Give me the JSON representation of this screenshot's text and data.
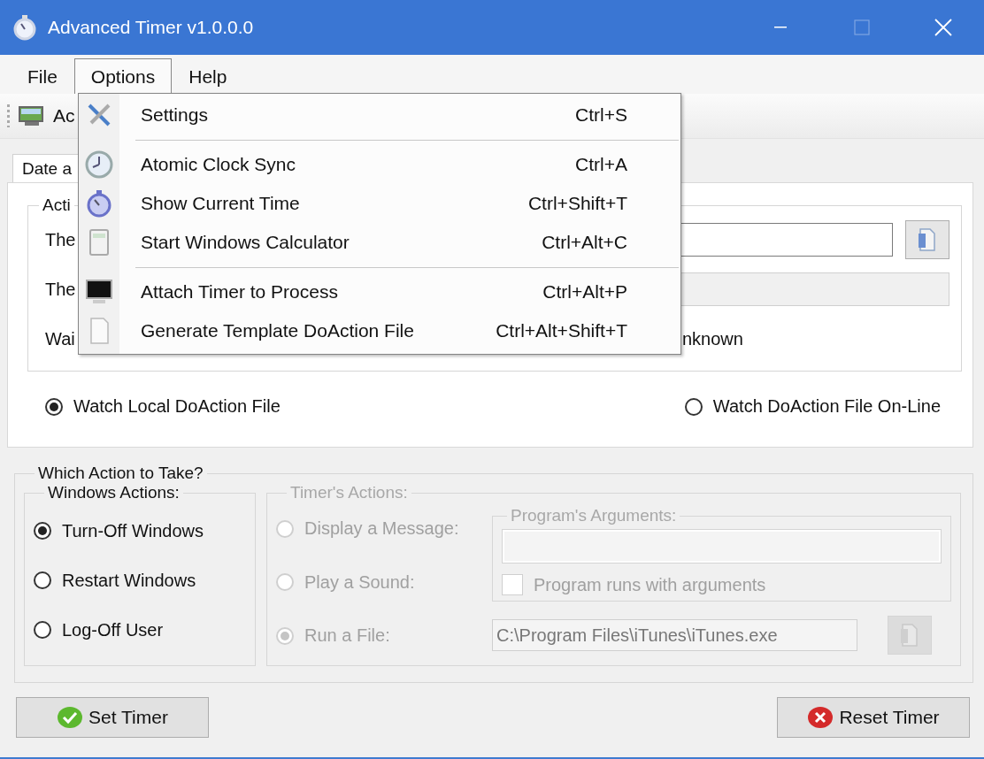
{
  "window": {
    "title": "Advanced Timer v1.0.0.0"
  },
  "menu_bar": [
    {
      "label": "File",
      "selected": false
    },
    {
      "label": "Options",
      "selected": true
    },
    {
      "label": "Help",
      "selected": false
    }
  ],
  "open_menu": {
    "items": [
      {
        "kind": "item",
        "label": "Settings",
        "shortcut": "Ctrl+S"
      },
      {
        "kind": "separator"
      },
      {
        "kind": "item",
        "label": "Atomic Clock Sync",
        "shortcut": "Ctrl+A"
      },
      {
        "kind": "item",
        "label": "Show Current Time",
        "shortcut": "Ctrl+Shift+T"
      },
      {
        "kind": "item",
        "label": "Start Windows Calculator",
        "shortcut": "Ctrl+Alt+C"
      },
      {
        "kind": "separator"
      },
      {
        "kind": "item",
        "label": "Attach Timer to Process",
        "shortcut": "Ctrl+Alt+P"
      },
      {
        "kind": "item",
        "label": "Generate Template DoAction File",
        "shortcut": "Ctrl+Alt+Shift+T"
      }
    ]
  },
  "toolbar": {
    "label": "Ac"
  },
  "tabs": [
    {
      "label": "Date a",
      "selected": true
    }
  ],
  "action_group": {
    "title": "Acti",
    "rows": [
      {
        "kind": "field",
        "label": "The"
      },
      {
        "kind": "disabled_field",
        "label": "The"
      },
      {
        "kind": "status",
        "label": "Wai",
        "value": "nknown"
      }
    ]
  },
  "watch_options": [
    {
      "label": "Watch Local DoAction File",
      "selected": true
    },
    {
      "label": "Watch DoAction File On-Line",
      "selected": false
    }
  ],
  "which_action": {
    "title": "Which Action to Take?",
    "windows_actions": {
      "title": "Windows Actions:",
      "disabled": false,
      "options": [
        {
          "label": "Turn-Off Windows",
          "selected": true
        },
        {
          "label": "Restart Windows",
          "selected": false
        },
        {
          "label": "Log-Off User",
          "selected": false
        }
      ]
    },
    "timers_actions": {
      "title": "Timer's Actions:",
      "disabled": true,
      "options": [
        {
          "label": "Display a Message:",
          "selected": false
        },
        {
          "label": "Play a Sound:",
          "selected": false
        },
        {
          "label": "Run a File:",
          "selected": true
        }
      ]
    },
    "program_arguments": {
      "title": "Program's Arguments:",
      "checkbox": {
        "label": "Program runs with arguments",
        "checked": false
      }
    },
    "file_path": {
      "value": "C:\\Program Files\\iTunes\\iTunes.exe"
    }
  },
  "buttons": [
    {
      "kind": "set",
      "label": "Set Timer"
    },
    {
      "kind": "reset",
      "label": "Reset Timer"
    }
  ]
}
